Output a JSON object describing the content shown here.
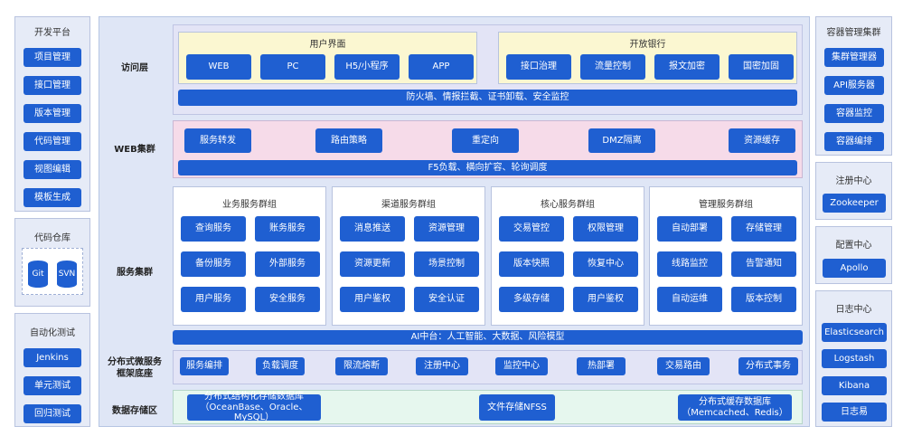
{
  "left": {
    "dev_platform": {
      "title": "开发平台",
      "items": [
        "项目管理",
        "接口管理",
        "版本管理",
        "代码管理",
        "视图编辑",
        "模板生成"
      ]
    },
    "code_repo": {
      "title": "代码仓库",
      "items": [
        "Git",
        "SVN"
      ]
    },
    "auto_test": {
      "title": "自动化测试",
      "items": [
        "Jenkins",
        "单元测试",
        "回归测试"
      ]
    }
  },
  "center": {
    "access": {
      "label": "访问层",
      "user_ui": {
        "title": "用户界面",
        "items": [
          "WEB",
          "PC",
          "H5/小程序",
          "APP"
        ]
      },
      "open_bank": {
        "title": "开放银行",
        "items": [
          "接口治理",
          "流量控制",
          "报文加密",
          "国密加固"
        ]
      },
      "bar": "防火墙、情报拦截、证书卸载、安全监控"
    },
    "web": {
      "label": "WEB集群",
      "items": [
        "服务转发",
        "路由策略",
        "重定向",
        "DMZ隔离",
        "资源缓存"
      ],
      "bar": "F5负载、横向扩容、轮询调度"
    },
    "service": {
      "label": "服务集群",
      "groups": [
        {
          "title": "业务服务群组",
          "items": [
            "查询服务",
            "账务服务",
            "备份服务",
            "外部服务",
            "用户服务",
            "安全服务"
          ]
        },
        {
          "title": "渠道服务群组",
          "items": [
            "消息推送",
            "资源管理",
            "资源更新",
            "场景控制",
            "用户鉴权",
            "安全认证"
          ]
        },
        {
          "title": "核心服务群组",
          "items": [
            "交易管控",
            "权限管理",
            "版本快照",
            "恢复中心",
            "多级存储",
            "用户鉴权"
          ]
        },
        {
          "title": "管理服务群组",
          "items": [
            "自动部署",
            "存储管理",
            "线路监控",
            "告警通知",
            "自动运维",
            "版本控制"
          ]
        }
      ]
    },
    "ai_bar": "AI中台：人工智能、大数据、风险模型",
    "micro": {
      "label1": "分布式微服务",
      "label2": "框架底座",
      "items": [
        "服务编排",
        "负载调度",
        "限流熔断",
        "注册中心",
        "监控中心",
        "热部署",
        "交易路由",
        "分布式事务"
      ]
    },
    "storage": {
      "label": "数据存储区",
      "structured1": "分布式结构化存储数据库",
      "structured2": "（OceanBase、Oracle、MySQL）",
      "nfs": "文件存储NFSS",
      "cache1": "分布式缓存数据库",
      "cache2": "（Memcached、Redis）"
    }
  },
  "right": {
    "container": {
      "title": "容器管理集群",
      "items": [
        "集群管理器",
        "API服务器",
        "容器监控",
        "容器编排"
      ]
    },
    "registry": {
      "title": "注册中心",
      "items": [
        "Zookeeper"
      ]
    },
    "config": {
      "title": "配置中心",
      "items": [
        "Apollo"
      ]
    },
    "log": {
      "title": "日志中心",
      "items": [
        "Elasticsearch",
        "Logstash",
        "Kibana",
        "日志易"
      ]
    }
  },
  "colors": {
    "accent": "#1f5fd1",
    "panel": "#dfe6f6",
    "yellow": "#fbf7d1",
    "pink": "#f6dbe9",
    "green": "#e6f7ee"
  }
}
